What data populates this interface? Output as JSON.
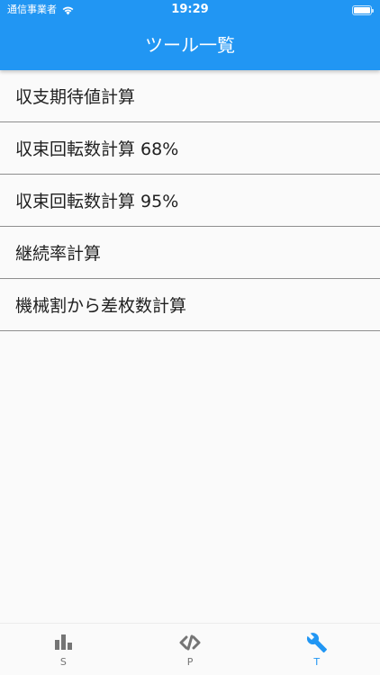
{
  "status_bar": {
    "carrier": "通信事業者",
    "time": "19:29"
  },
  "app_bar": {
    "title": "ツール一覧"
  },
  "tools": [
    {
      "label": "収支期待値計算"
    },
    {
      "label": "収束回転数計算 68%"
    },
    {
      "label": "収束回転数計算 95%"
    },
    {
      "label": "継続率計算"
    },
    {
      "label": "機械割から差枚数計算"
    }
  ],
  "tabs": [
    {
      "label": "S",
      "icon": "bar-chart-icon",
      "active": false
    },
    {
      "label": "P",
      "icon": "code-icon",
      "active": false
    },
    {
      "label": "T",
      "icon": "wrench-icon",
      "active": true
    }
  ],
  "colors": {
    "primary": "#2196f3",
    "inactive": "#757575",
    "divider": "#8e8e8e",
    "background": "#fafafa"
  }
}
